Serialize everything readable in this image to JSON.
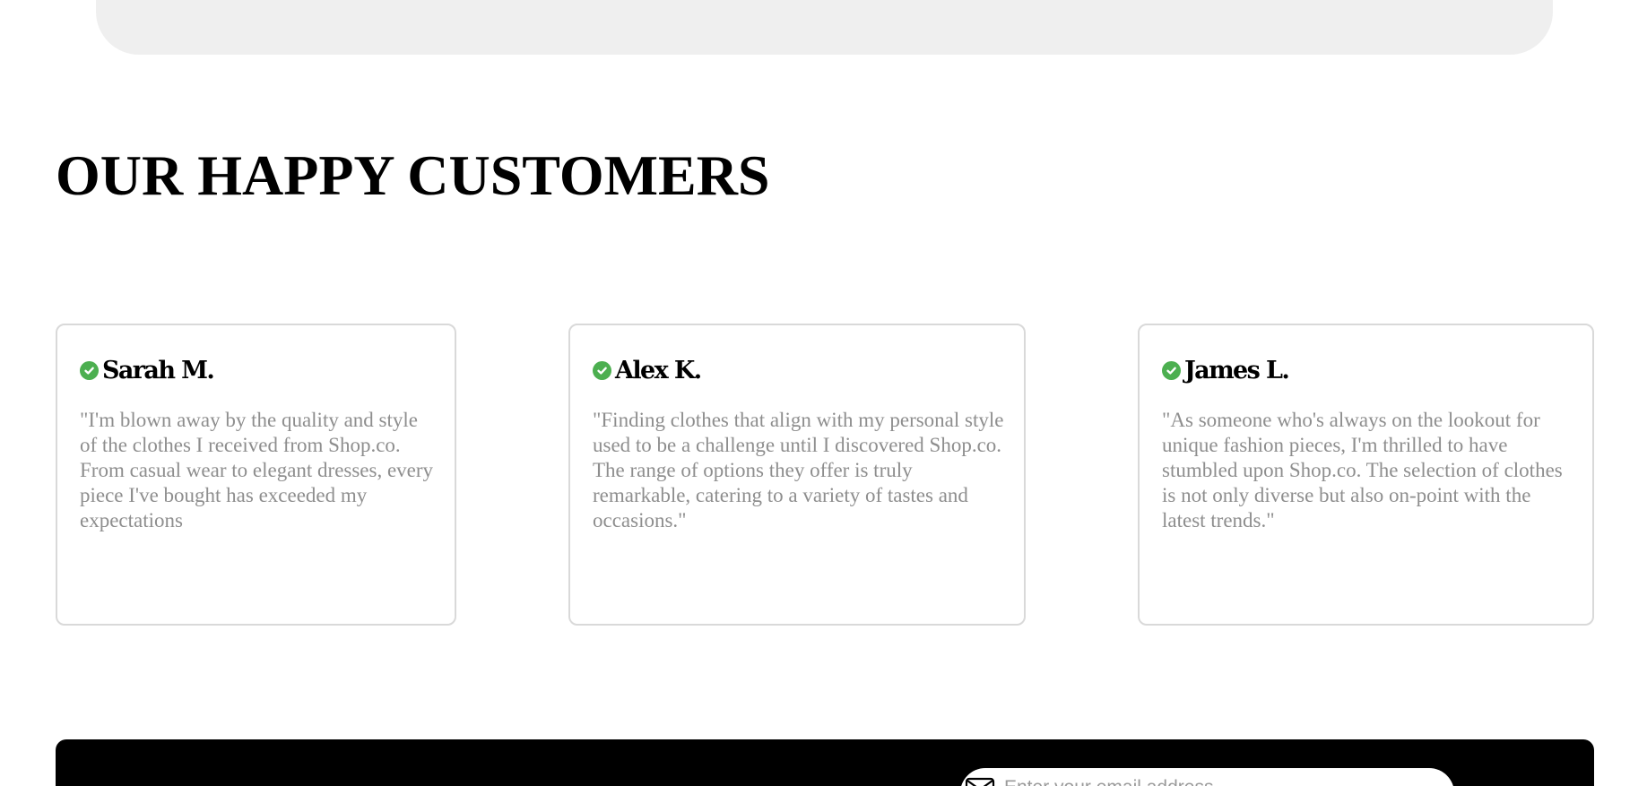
{
  "section": {
    "title": "OUR HAPPY CUSTOMERS"
  },
  "reviews": [
    {
      "name": "Sarah M.",
      "verified": true,
      "text": "\"I'm blown away by the quality and style of the clothes I received from Shop.co. From casual wear to elegant dresses, every piece I've bought has exceeded my expectations"
    },
    {
      "name": "Alex K.",
      "verified": true,
      "text": "\"Finding clothes that align with my personal style used to be a challenge until I discovered Shop.co. The range of options they offer is truly remarkable, catering to a variety of tastes and occasions.\""
    },
    {
      "name": "James L.",
      "verified": true,
      "text": "\"As someone who's always on the lookout for unique fashion pieces, I'm thrilled to have stumbled upon Shop.co. The selection of clothes is not only diverse but also on-point with the latest trends.\""
    }
  ],
  "newsletter": {
    "placeholder": "Enter your email address",
    "icon": "mail-icon"
  },
  "colors": {
    "verified_badge": "#4caf50",
    "review_text": "#8e8e8e",
    "card_border": "#d9d9d9",
    "banner_bg": "#efefef",
    "footer_bg": "#000000"
  }
}
